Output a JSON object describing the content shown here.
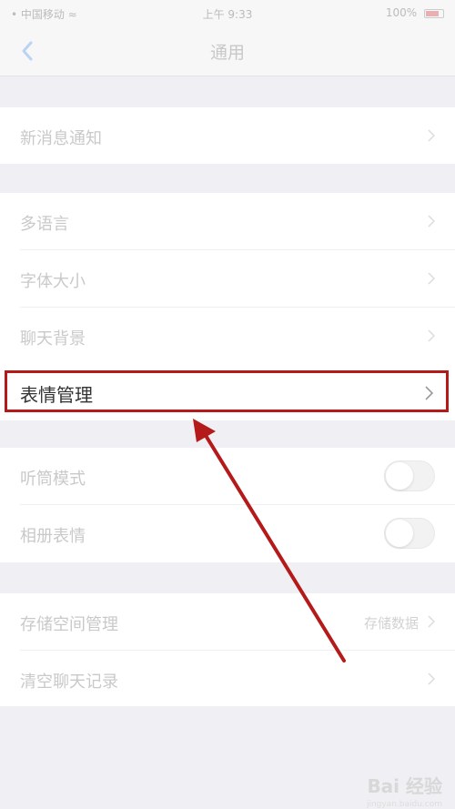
{
  "status_bar": {
    "carrier": "• 中国移动 ≈",
    "time": "上午 9:33",
    "battery": "100%"
  },
  "nav": {
    "title": "通用"
  },
  "rows": {
    "multilang": "多语言",
    "font_size": "字体大小",
    "chat_bg": "聊天背景",
    "emoji": "表情管理",
    "listen_mode": "听筒模式",
    "photo_sticker": "相册表情",
    "storage": "存储空间管理",
    "storage_value": "存储数据",
    "clear_chat": "清空聊天记录",
    "new_notify": "新消息通知"
  },
  "watermark": {
    "text": "Bai 经验",
    "sub": "jingyan.baidu.com"
  },
  "colors": {
    "highlight": "#b51a1a"
  }
}
